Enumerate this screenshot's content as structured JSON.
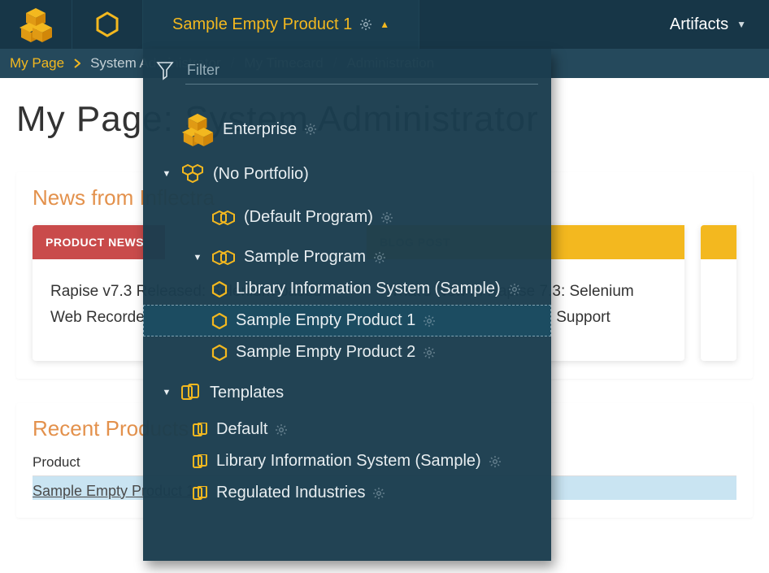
{
  "header": {
    "selected_product": "Sample Empty Product 1",
    "artifacts_label": "Artifacts"
  },
  "breadcrumb": {
    "items": [
      "My Page",
      "System Administrator",
      "My Timecard",
      "Administration"
    ],
    "active_index": 0
  },
  "page": {
    "title": "My Page: System Administrator"
  },
  "news_panel": {
    "title": "News from Inflectra",
    "cards": [
      {
        "tag": "PRODUCT NEWS",
        "kind": "red",
        "body": "Rapise v7.3 Released: Selenium-based Web Recorder, Shadow DOM and …"
      },
      {
        "tag": "BLOG POST",
        "kind": "yellow",
        "body": "What's New in Rapise 7.3: Selenium Recorder, Shadow DOM Support"
      },
      {
        "tag": "",
        "kind": "yellow",
        "body": ""
      }
    ]
  },
  "recent_panel": {
    "title": "Recent Products",
    "column": "Product",
    "rows": [
      "Sample Empty Product 1"
    ]
  },
  "dropdown": {
    "filter_placeholder": "Filter",
    "enterprise": "Enterprise",
    "tree": [
      {
        "label": "(No Portfolio)",
        "level": 1,
        "icon": "portfolio",
        "caret": true,
        "gear": false
      },
      {
        "label": "(Default Program)",
        "level": 2,
        "icon": "program",
        "caret": false,
        "gear": true
      },
      {
        "label": "Sample Program",
        "level": 2,
        "icon": "program",
        "caret": true,
        "gear": true
      },
      {
        "label": "Library Information System (Sample)",
        "level": 3,
        "icon": "product",
        "caret": false,
        "gear": true
      },
      {
        "label": "Sample Empty Product 1",
        "level": 3,
        "icon": "product",
        "caret": false,
        "gear": true,
        "selected": true
      },
      {
        "label": "Sample Empty Product 2",
        "level": 3,
        "icon": "product",
        "caret": false,
        "gear": true
      },
      {
        "label": "Templates",
        "level": 1,
        "icon": "templates",
        "caret": true,
        "gear": false
      },
      {
        "label": "Default",
        "level": 2,
        "icon": "template",
        "caret": false,
        "gear": true
      },
      {
        "label": "Library Information System (Sample)",
        "level": 2,
        "icon": "template",
        "caret": false,
        "gear": true
      },
      {
        "label": "Regulated Industries",
        "level": 2,
        "icon": "template",
        "caret": false,
        "gear": true
      }
    ]
  },
  "colors": {
    "brand_yellow": "#f3b81f",
    "bg_dark": "#173647",
    "bg_dropdown": "#1b3d4e",
    "accent_orange": "#e3914c",
    "tag_red": "#c94b4b"
  }
}
